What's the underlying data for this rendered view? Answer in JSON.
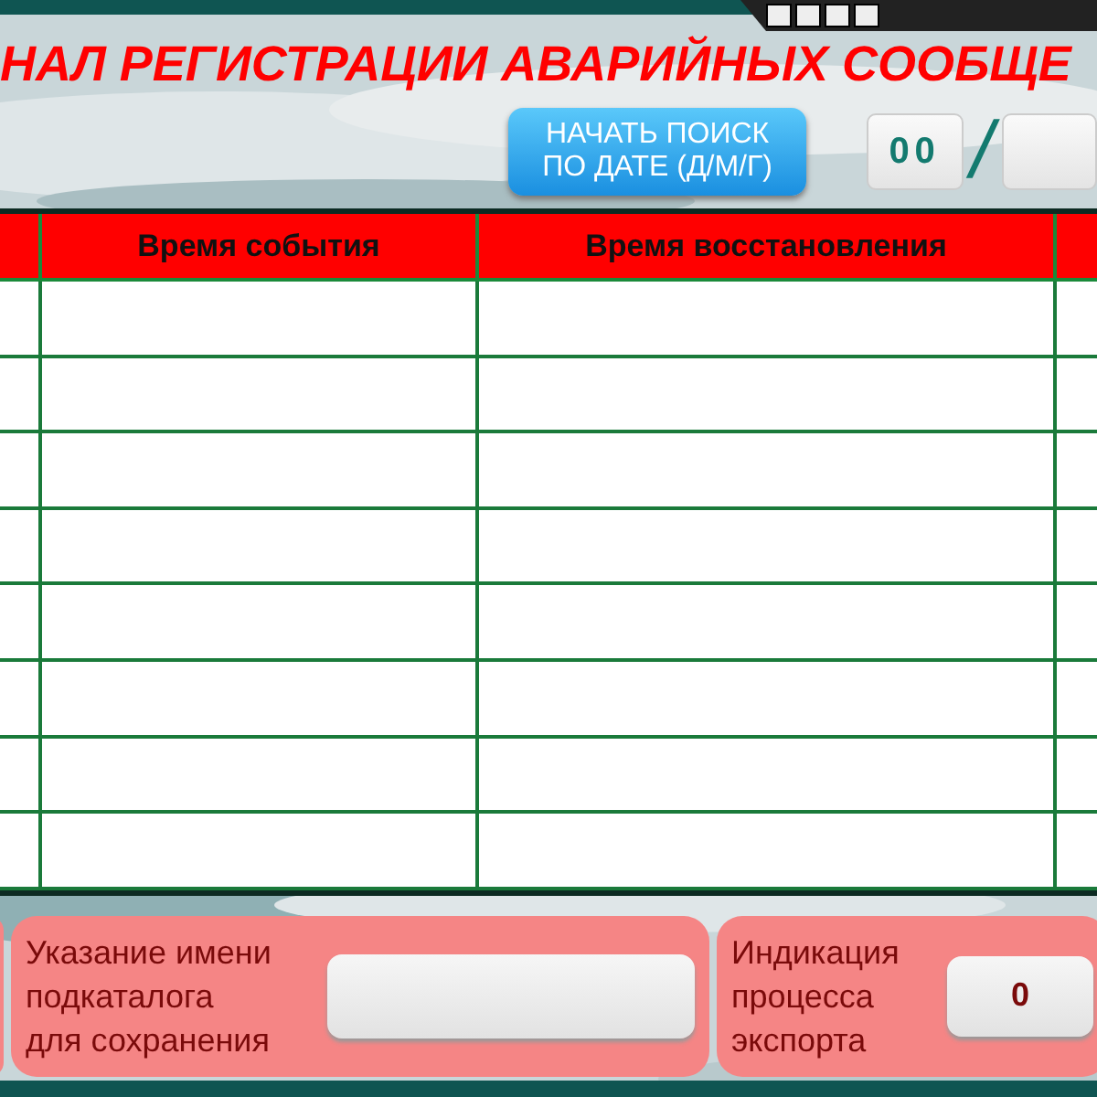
{
  "title": "НАЛ РЕГИСТРАЦИИ АВАРИЙНЫХ СООБЩЕ",
  "search_button": {
    "label_lines": [
      "НАЧАТЬ ПОИСК",
      "ПО ДАТЕ (Д/М/Г)"
    ]
  },
  "date_fields": [
    {
      "value": "00"
    }
  ],
  "date_separator": "/",
  "table": {
    "columns": [
      "Время события",
      "Время восстановления"
    ]
  },
  "subfolder_panel": {
    "label_lines": [
      "Указание имени",
      "подкаталога",
      "для сохранения"
    ]
  },
  "export_panel": {
    "label_lines": [
      "Индикация",
      "процесса",
      "экспорта"
    ],
    "value": "0"
  }
}
